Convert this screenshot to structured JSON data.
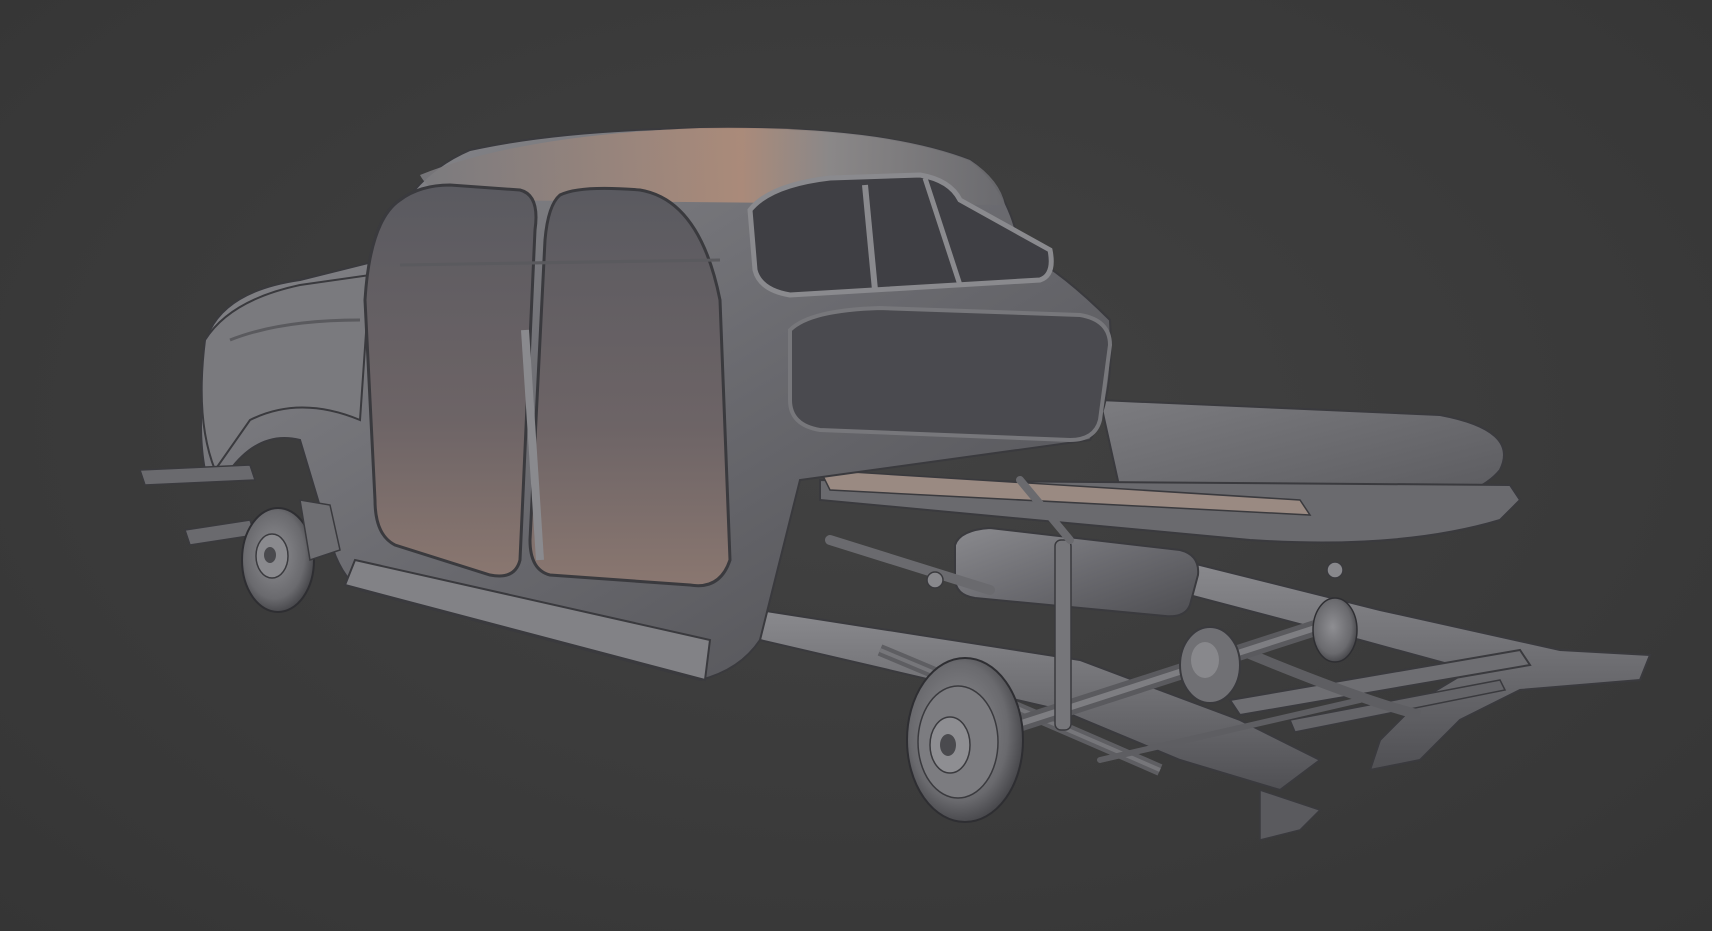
{
  "viewport": {
    "background_color": "#3c3c3c",
    "model_color": "#6e6e72",
    "highlight_color": "#b08d7a",
    "shadow_color": "#2a2a2c"
  },
  "model": {
    "parts": [
      "car-body-shell",
      "roof",
      "front-fender",
      "rear-window",
      "door-openings",
      "trunk-panel",
      "rear-deck-extension",
      "chassis-frame",
      "front-wheel-hub",
      "rear-wheel-hub",
      "rear-axle",
      "differential",
      "leaf-springs",
      "fuel-tank",
      "shock-absorbers"
    ]
  }
}
